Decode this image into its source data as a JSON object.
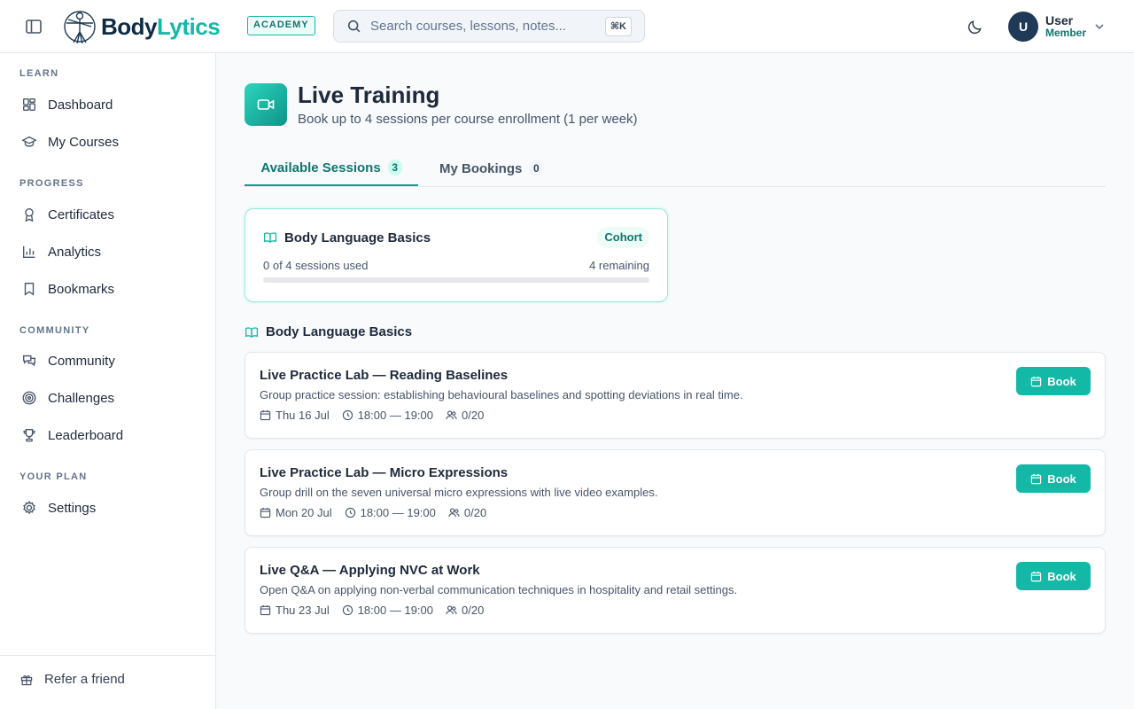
{
  "header": {
    "logo_part1": "Body",
    "logo_part2": "Lytics",
    "academy_badge": "ACADEMY",
    "search_placeholder": "Search courses, lessons, notes...",
    "search_shortcut": "⌘K",
    "user": {
      "initial": "U",
      "name": "User",
      "role": "Member"
    }
  },
  "sidebar": {
    "sections": [
      {
        "label": "LEARN",
        "items": [
          {
            "label": "Dashboard",
            "icon": "dashboard-icon"
          },
          {
            "label": "My Courses",
            "icon": "graduation-cap-icon"
          }
        ]
      },
      {
        "label": "PROGRESS",
        "items": [
          {
            "label": "Certificates",
            "icon": "award-icon"
          },
          {
            "label": "Analytics",
            "icon": "bar-chart-icon"
          },
          {
            "label": "Bookmarks",
            "icon": "bookmark-icon"
          }
        ]
      },
      {
        "label": "COMMUNITY",
        "items": [
          {
            "label": "Community",
            "icon": "chat-icon"
          },
          {
            "label": "Challenges",
            "icon": "target-icon"
          },
          {
            "label": "Leaderboard",
            "icon": "trophy-icon"
          }
        ]
      },
      {
        "label": "YOUR PLAN",
        "items": [
          {
            "label": "Settings",
            "icon": "gear-icon"
          }
        ]
      }
    ],
    "footer": {
      "label": "Refer a friend",
      "icon": "gift-icon"
    }
  },
  "page": {
    "title": "Live Training",
    "subtitle": "Book up to 4 sessions per course enrollment (1 per week)"
  },
  "tabs": [
    {
      "label": "Available Sessions",
      "count": "3",
      "active": true
    },
    {
      "label": "My Bookings",
      "count": "0",
      "active": false
    }
  ],
  "course_card": {
    "title": "Body Language Basics",
    "badge": "Cohort",
    "used_text": "0 of 4 sessions used",
    "remaining_text": "4 remaining",
    "progress_fraction": 0
  },
  "group": {
    "title": "Body Language Basics"
  },
  "sessions": [
    {
      "title": "Live Practice Lab — Reading Baselines",
      "description": "Group practice session: establishing behavioural baselines and spotting deviations in real time.",
      "date": "Thu 16 Jul",
      "time": "18:00 — 19:00",
      "capacity": "0/20",
      "button": "Book"
    },
    {
      "title": "Live Practice Lab — Micro Expressions",
      "description": "Group drill on the seven universal micro expressions with live video examples.",
      "date": "Mon 20 Jul",
      "time": "18:00 — 19:00",
      "capacity": "0/20",
      "button": "Book"
    },
    {
      "title": "Live Q&A — Applying NVC at Work",
      "description": "Open Q&A on applying non-verbal communication techniques in hospitality and retail settings.",
      "date": "Thu 23 Jul",
      "time": "18:00 — 19:00",
      "capacity": "0/20",
      "button": "Book"
    }
  ],
  "colors": {
    "accent": "#14b8a6",
    "accent_dark": "#0f766e",
    "navy": "#0f2a44"
  }
}
